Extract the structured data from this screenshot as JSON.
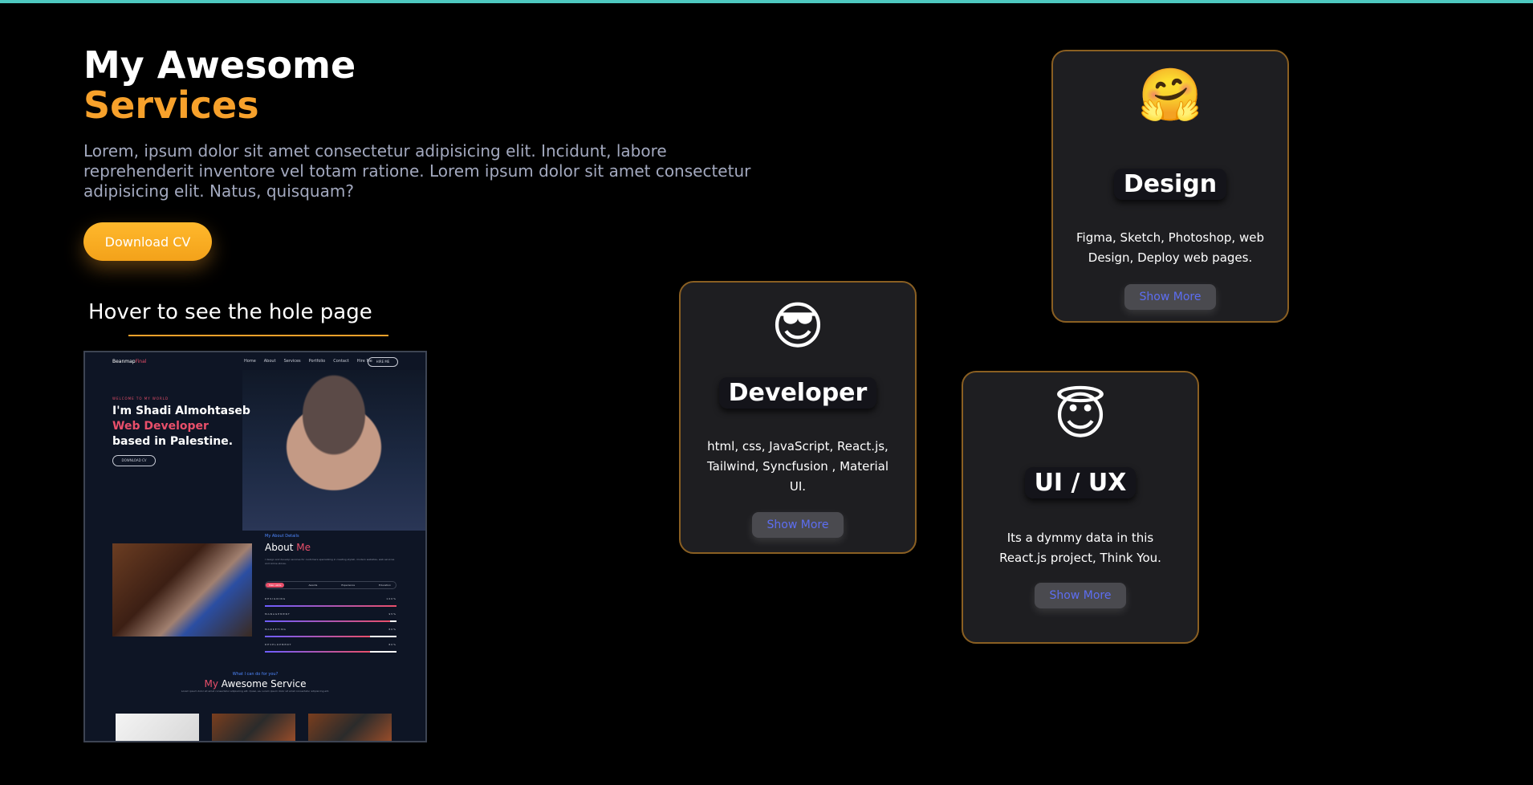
{
  "hero": {
    "title_line1": "My Awesome",
    "title_line2": "Services",
    "description": "Lorem, ipsum dolor sit amet consectetur adipisicing elit. Incidunt, labore reprehenderit inventore vel totam ratione. Lorem ipsum dolor sit amet consectetur adipisicing elit. Natus, quisquam?",
    "download_label": "Download CV"
  },
  "preview": {
    "heading": "Hover to see the hole page",
    "brand_main": "Beanmap",
    "brand_accent": "Final",
    "nav_links": [
      "Home",
      "About",
      "Services",
      "Portfolio",
      "Contact",
      "Hire Me"
    ],
    "hire_label": "HIRE ME",
    "welcome": "WELCOME TO MY WORLD",
    "name_line": "I'm Shadi Almohtaseb",
    "role_line": "Web Developer",
    "location_line": "based in Palestine.",
    "download_label": "DOWNLOAD CV",
    "about_kicker": "My About Details",
    "about_title_main": "About ",
    "about_title_accent": "Me",
    "about_text": "I design and develop services for customers specializing in creating stylish, modern websites, web services and online stores.",
    "tabs": [
      "Main skills",
      "Awards",
      "Experience",
      "Education"
    ],
    "skills": [
      {
        "label": "DESIGNING",
        "percent": "100%",
        "value": 100
      },
      {
        "label": "MANAGEMENT",
        "percent": "95%",
        "value": 95
      },
      {
        "label": "MARKETING",
        "percent": "80%",
        "value": 80
      },
      {
        "label": "DEVELOPMENT",
        "percent": "80%",
        "value": 80
      }
    ],
    "svc_kicker": "What I can do for you?",
    "svc_title_accent": "My",
    "svc_title_main": " Awesome Service",
    "svc_text": "Lorem ipsum dolor sit amet consectetur adipisicing elit. Quasi, ea. Lorem ipsum dolor sit amet consectetur adipisicing elit."
  },
  "cards": [
    {
      "emoji": "🤗",
      "title": "Design",
      "text": "Figma, Sketch, Photoshop, web Design, Deploy web pages.",
      "button": "Show More"
    },
    {
      "emoji": "😎",
      "title": "Developer",
      "text": "html, css, JavaScript, React.js, Tailwind, Syncfusion , Material UI.",
      "button": "Show More"
    },
    {
      "emoji": "😇",
      "title": "UI / UX",
      "text": "Its a dymmy data in this React.js project, Think You.",
      "button": "Show More"
    }
  ],
  "colors": {
    "accent": "#f7a12b",
    "top_bar": "#4ec9c0",
    "card_border": "#8a5f22",
    "button_text": "#5d6ef2"
  }
}
